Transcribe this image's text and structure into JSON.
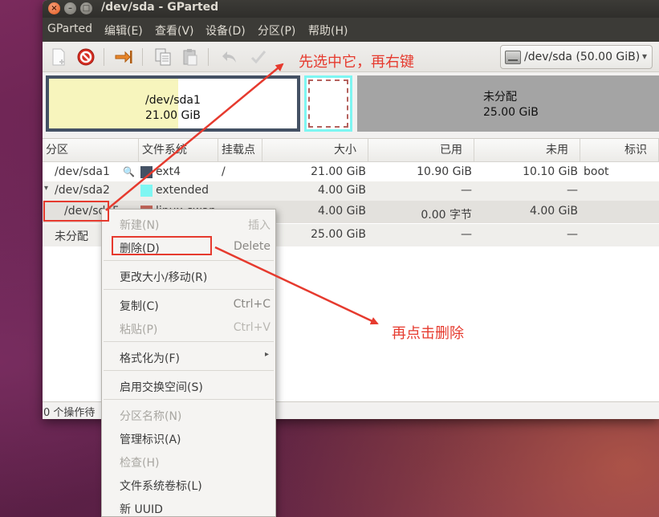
{
  "window": {
    "title": "/dev/sda - GParted"
  },
  "window_controls": {
    "close": "×",
    "minimize": "–",
    "maximize": "□"
  },
  "menubar": {
    "items": [
      "GParted",
      "编辑(E)",
      "查看(V)",
      "设备(D)",
      "分区(P)",
      "帮助(H)"
    ]
  },
  "toolbar": {
    "buttons": [
      "new-partition-icon",
      "delete-partition-icon",
      "resize-move-icon",
      "copy-icon",
      "paste-icon",
      "undo-icon",
      "apply-icon"
    ],
    "device": {
      "name": "/dev/sda",
      "size": "(50.00 GiB)",
      "arrow": "▾"
    }
  },
  "partition_map": {
    "sda1": {
      "name": "/dev/sda1",
      "size": "21.00 GiB",
      "used_fraction": 0.52
    },
    "unallocated": {
      "name": "未分配",
      "size": "25.00 GiB"
    }
  },
  "table": {
    "headers": [
      "分区",
      "文件系统",
      "挂载点",
      "大小",
      "已用",
      "未用",
      "标识"
    ],
    "rows": [
      {
        "partition": "/dev/sda1",
        "filesystem": "ext4",
        "fs_color": "#445164",
        "mount": "/",
        "size": "21.00 GiB",
        "used": "10.90 GiB",
        "unused": "10.10 GiB",
        "flags": "boot"
      },
      {
        "partition": "/dev/sda2",
        "filesystem": "extended",
        "fs_color": "#7ef6f2",
        "mount": "",
        "size": "4.00 GiB",
        "used": "—",
        "unused": "—",
        "flags": ""
      },
      {
        "partition": "/dev/sda5",
        "filesystem": "linux-swap",
        "fs_color": "#c1665a",
        "mount": "",
        "size": "4.00 GiB",
        "used": "0.00 字节",
        "unused": "4.00 GiB",
        "flags": ""
      },
      {
        "partition": "未分配",
        "filesystem": "",
        "fs_color": "",
        "mount": "",
        "size": "25.00 GiB",
        "used": "—",
        "unused": "—",
        "flags": ""
      }
    ],
    "expander": "▾",
    "lock_glyph": "🔍"
  },
  "statusbar": {
    "text": "0 个操作待"
  },
  "context_menu": {
    "items": [
      {
        "label": "新建(N)",
        "accel": "插入",
        "enabled": false
      },
      {
        "label": "删除(D)",
        "accel": "Delete",
        "enabled": true
      },
      {
        "label": "更改大小/移动(R)",
        "accel": "",
        "enabled": true
      },
      {
        "label": "复制(C)",
        "accel": "Ctrl+C",
        "enabled": true
      },
      {
        "label": "粘贴(P)",
        "accel": "Ctrl+V",
        "enabled": false
      },
      {
        "label": "格式化为(F)",
        "accel": "",
        "enabled": true,
        "submenu": "▸"
      },
      {
        "label": "启用交换空间(S)",
        "accel": "",
        "enabled": true
      },
      {
        "label": "分区名称(N)",
        "accel": "",
        "enabled": false
      },
      {
        "label": "管理标识(A)",
        "accel": "",
        "enabled": true
      },
      {
        "label": "检查(H)",
        "accel": "",
        "enabled": false
      },
      {
        "label": "文件系统卷标(L)",
        "accel": "",
        "enabled": true
      },
      {
        "label": "新 UUID",
        "accel": "",
        "enabled": true
      }
    ]
  },
  "annotations": {
    "step1": "先选中它，再右键",
    "step2": "再点击删除",
    "color": "#e63a2e"
  }
}
